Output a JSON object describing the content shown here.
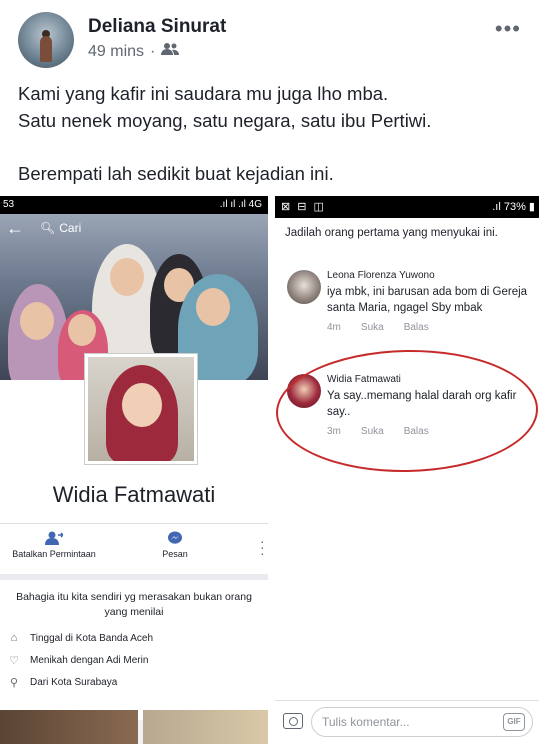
{
  "post": {
    "author": "Deliana Sinurat",
    "time": "49 mins",
    "separator": "·",
    "audience_icon": "friends-icon",
    "more": "•••",
    "caption_lines": [
      "Kami yang kafir ini saudara mu juga lho mba.",
      "Satu nenek moyang, satu negara, satu ibu Pertiwi.",
      "Berempati lah sedikit buat kejadian ini."
    ]
  },
  "left_screenshot": {
    "status_left": "53",
    "status_right": "⠀.ıl ıl .ıl 4G",
    "search_label": "Cari",
    "profile_name": "Widia Fatmawati",
    "actions": {
      "cancel_request": "Batalkan Permintaan",
      "message": "Pesan"
    },
    "bio": "Bahagia itu kita sendiri yg merasakan bukan orang yang menilai",
    "info": {
      "lives": "Tinggal di Kota Banda Aceh",
      "relationship": "Menikah dengan Adi Merin",
      "from": "Dari Kota Surabaya"
    }
  },
  "right_screenshot": {
    "status_left": "⊠ ⊟ ◫",
    "status_right": ".ıl 73% ▮",
    "likes_first": "Jadilah orang pertama yang menyukai ini.",
    "comments": [
      {
        "name": "Leona Florenza Yuwono",
        "text": "iya mbk, ini barusan ada bom di Gereja santa Maria, ngagel Sby mbak",
        "time": "4m",
        "like": "Suka",
        "reply": "Balas"
      },
      {
        "name": "Widia Fatmawati",
        "text": "Ya say..memang halal darah org kafir say..",
        "time": "3m",
        "like": "Suka",
        "reply": "Balas"
      }
    ],
    "comment_placeholder": "Tulis komentar...",
    "gif_label": "GIF"
  },
  "colors": {
    "annotation_red": "#c72a2a",
    "meta_gray": "#90949c",
    "fb_blue": "#4267b2"
  }
}
